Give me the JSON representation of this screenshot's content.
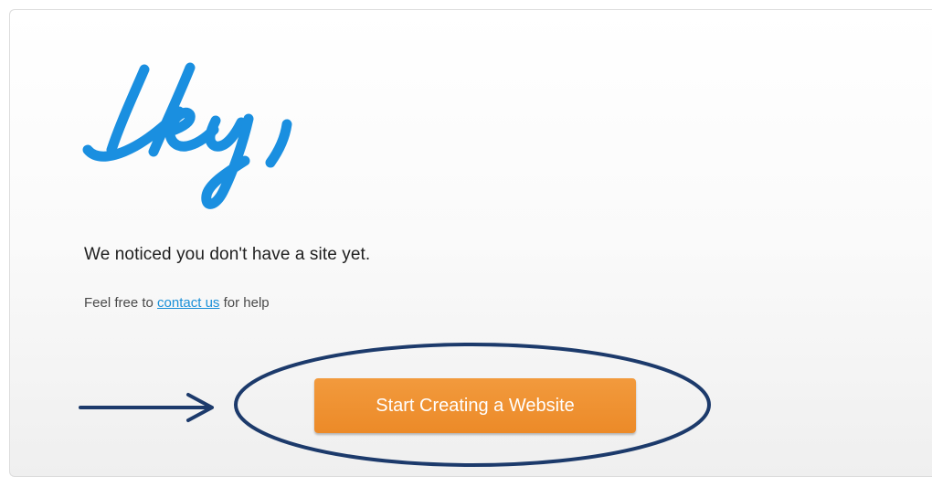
{
  "greeting": {
    "text": "Hey,",
    "color": "#1a8fe0"
  },
  "message": {
    "headline": "We noticed you don't have a site yet.",
    "help_prefix": "Feel free to ",
    "help_link": "contact us",
    "help_suffix": " for help"
  },
  "cta": {
    "label": "Start Creating a Website",
    "color": "#ec8a28"
  },
  "annotation": {
    "color": "#1c3a6b",
    "icons": [
      "arrow-right-icon",
      "highlight-ellipse"
    ]
  }
}
